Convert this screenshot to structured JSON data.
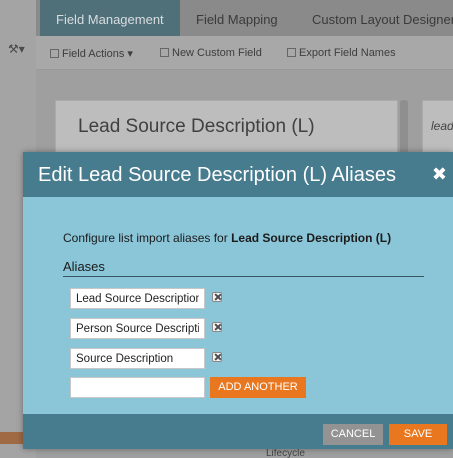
{
  "background": {
    "tabs": [
      "Field Management",
      "Field Mapping",
      "Custom Layout Designer"
    ],
    "toolbar": {
      "field_actions": "Field Actions",
      "new_custom_field": "New Custom Field",
      "export_field_names": "Export Field Names"
    },
    "card_title": "Lead Source Description (L)",
    "side_card_text": "lead",
    "bottom_text": "Lifecycle"
  },
  "modal": {
    "title": "Edit Lead Source Description (L) Aliases",
    "close_glyph": "✖",
    "description_prefix": "Configure list import aliases for ",
    "description_field": "Lead Source Description (L)",
    "section_label": "Aliases",
    "aliases": [
      "Lead Source Description",
      "Person Source Description",
      "Source Description"
    ],
    "new_alias_value": "",
    "add_another_label": "ADD ANOTHER",
    "cancel_label": "CANCEL",
    "save_label": "SAVE"
  },
  "colors": {
    "modal_header": "#477b8e",
    "modal_body": "#8ac5d8",
    "accent_orange": "#e9771f",
    "cancel_gray": "#939393"
  }
}
